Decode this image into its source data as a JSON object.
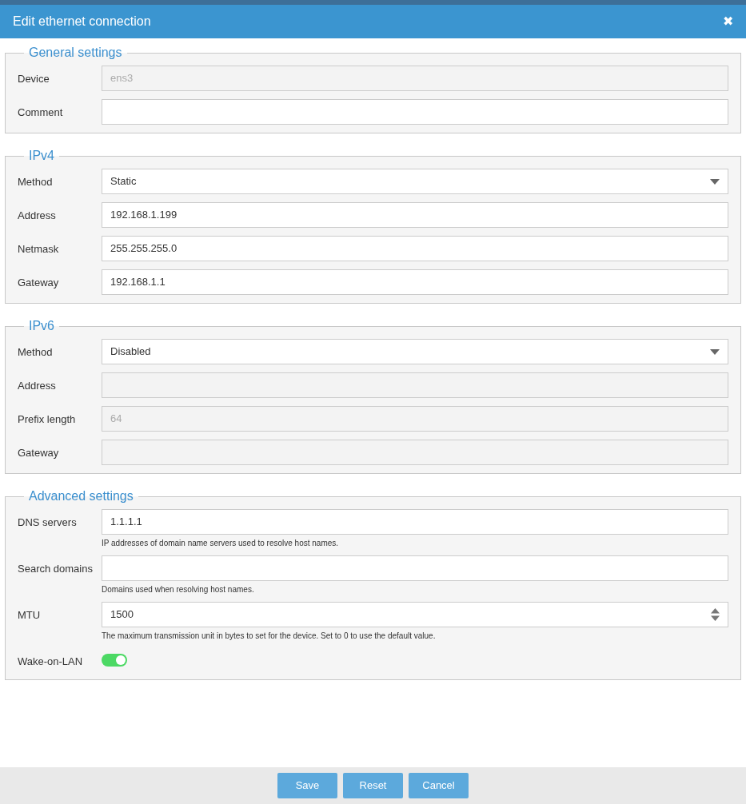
{
  "window": {
    "title": "Edit ethernet connection",
    "close": "✖"
  },
  "sections": [
    {
      "legend": "General settings",
      "fields": [
        {
          "label": "Device",
          "kind": "text",
          "value": "ens3",
          "disabled": true
        },
        {
          "label": "Comment",
          "kind": "text",
          "disabled": false
        }
      ]
    },
    {
      "legend": "IPv4",
      "fields": [
        {
          "label": "Method",
          "kind": "select",
          "value": "Static",
          "disabled": false
        },
        {
          "label": "Address",
          "kind": "text",
          "value": "192.168.1.199",
          "disabled": false
        },
        {
          "label": "Netmask",
          "kind": "text",
          "value": "255.255.255.0",
          "disabled": false
        },
        {
          "label": "Gateway",
          "kind": "text",
          "value": "192.168.1.1",
          "disabled": false
        }
      ]
    },
    {
      "legend": "IPv6",
      "fields": [
        {
          "label": "Method",
          "kind": "select",
          "value": "Disabled",
          "disabled": false
        },
        {
          "label": "Address",
          "kind": "text",
          "disabled": true
        },
        {
          "label": "Prefix length",
          "kind": "text",
          "value": "64",
          "disabled": true
        },
        {
          "label": "Gateway",
          "kind": "text",
          "disabled": true
        }
      ]
    },
    {
      "legend": "Advanced settings",
      "fields": [
        {
          "label": "DNS servers",
          "kind": "text",
          "value": "1.1.1.1",
          "disabled": false,
          "hint": "IP addresses of domain name servers used to resolve host names."
        },
        {
          "label": "Search domains",
          "kind": "text",
          "disabled": false,
          "hint": "Domains used when resolving host names."
        },
        {
          "label": "MTU",
          "kind": "number",
          "value": "1500",
          "disabled": false,
          "hint": "The maximum transmission unit in bytes to set for the device. Set to 0 to use the default value."
        },
        {
          "label": "Wake-on-LAN",
          "kind": "switch",
          "on": true
        }
      ]
    }
  ],
  "buttons": [
    "Save",
    "Reset",
    "Cancel"
  ]
}
